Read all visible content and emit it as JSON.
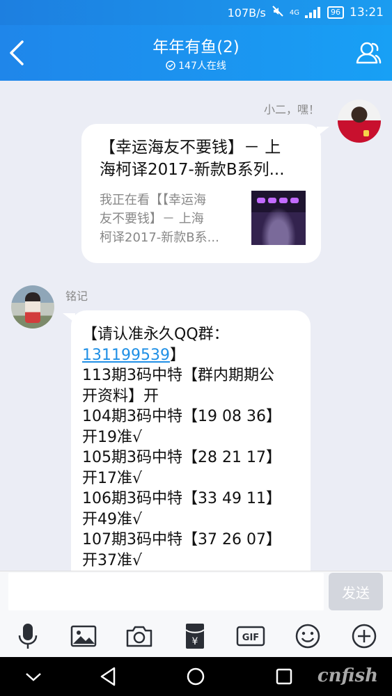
{
  "status_bar": {
    "net_speed": "107B/s",
    "network_label": "4G",
    "battery": "96",
    "time": "13:21"
  },
  "header": {
    "title": "年年有鱼(2)",
    "online": "147人在线"
  },
  "messages": [
    {
      "sender": "小二，嘿！",
      "side": "right",
      "type": "share",
      "title": "【幸运海友不要钱】－上海柯译2017-新款B系列...",
      "title_lines": [
        "【幸运海友不要钱】－ 上",
        "海柯译2017-新款B系列..."
      ],
      "desc_lines": [
        "我正在看【【幸运海",
        "友不要钱】－ 上海",
        "柯译2017-新款B系..."
      ]
    },
    {
      "sender": "铭记",
      "side": "left",
      "type": "text",
      "line0_prefix": "【请认准永久QQ群：",
      "link": "131199539",
      "line1_suffix": "】",
      "lines": [
        "113期3码中特【群内期期公",
        "开资料】开",
        "104期3码中特【19 08 36】",
        "开19准√",
        "105期3码中特【28 21 17】",
        "开17准√",
        "106期3码中特【33 49 11】",
        "开49准√",
        "107期3码中特【37 26 07】",
        "开37准√"
      ]
    }
  ],
  "input": {
    "placeholder": "",
    "value": "",
    "send_label": "发送"
  },
  "toolbar": [
    "microphone-icon",
    "image-icon",
    "camera-icon",
    "red-packet-icon",
    "gif-icon",
    "emoji-icon",
    "plus-icon"
  ],
  "watermark": "cnfish",
  "colors": {
    "header": "#1f8aea",
    "link": "#1f8fe5",
    "background": "#ebedf5"
  }
}
